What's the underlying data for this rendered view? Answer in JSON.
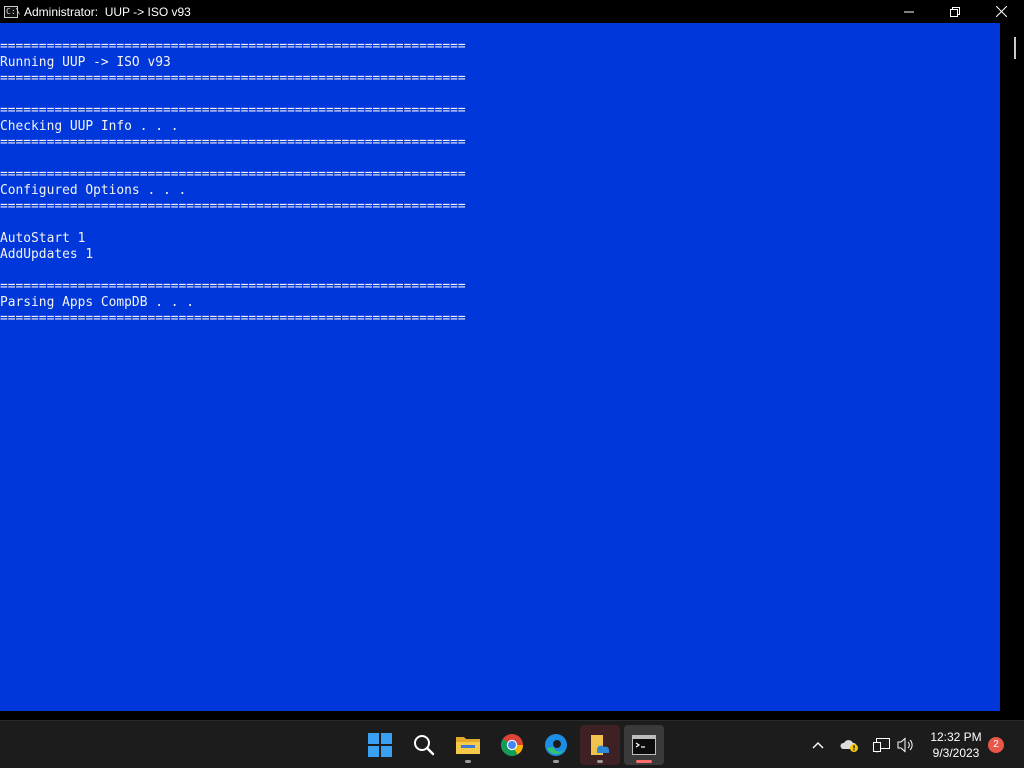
{
  "window": {
    "title": "Administrator:  UUP -> ISO v93",
    "app_icon": "cmd-icon",
    "controls": [
      "minimize-icon",
      "maximize-icon",
      "close-icon"
    ]
  },
  "console": {
    "background": "#0037da",
    "foreground": "#f2f2f2",
    "lines": [
      "============================================================",
      "Running UUP -> ISO v93",
      "============================================================",
      "",
      "============================================================",
      "Checking UUP Info . . .",
      "============================================================",
      "",
      "============================================================",
      "Configured Options . . .",
      "============================================================",
      "",
      "AutoStart 1",
      "AddUpdates 1",
      "",
      "============================================================",
      "Parsing Apps CompDB . . .",
      "============================================================"
    ]
  },
  "taskbar": {
    "apps": [
      "start-icon",
      "search-icon",
      "file-explorer-icon",
      "chrome-icon",
      "edge-icon",
      "onedrive-folder-icon",
      "terminal-icon"
    ],
    "tray": [
      "chevron-up-icon",
      "cloud-warning-icon",
      "network-icon",
      "volume-icon"
    ],
    "clock": {
      "time": "12:32 PM",
      "date": "9/3/2023"
    },
    "notification_count": "2"
  }
}
